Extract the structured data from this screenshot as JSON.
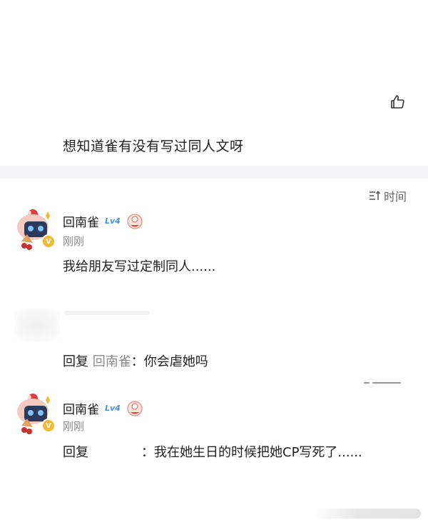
{
  "post": {
    "text": "想知道雀有没有写过同人文呀"
  },
  "sort": {
    "label": "时间",
    "icon": "sort-icon"
  },
  "comments": [
    {
      "username": "回南雀",
      "level": "Lv4",
      "time": "刚刚",
      "text": "我给朋友写过定制同人......"
    },
    {
      "reply_prefix": "回复",
      "mention": "回南雀",
      "colon": "：",
      "text": "你会虐她吗"
    },
    {
      "username": "回南雀",
      "level": "Lv4",
      "time": "刚刚",
      "reply_prefix": "回复",
      "colon": "：",
      "text": "我在她生日的时候把她CP写死了......"
    }
  ],
  "colors": {
    "level": "#4a90e2",
    "muted": "#8a8a8a",
    "badge": "#f5b82e",
    "band": "#f3f4f6"
  }
}
